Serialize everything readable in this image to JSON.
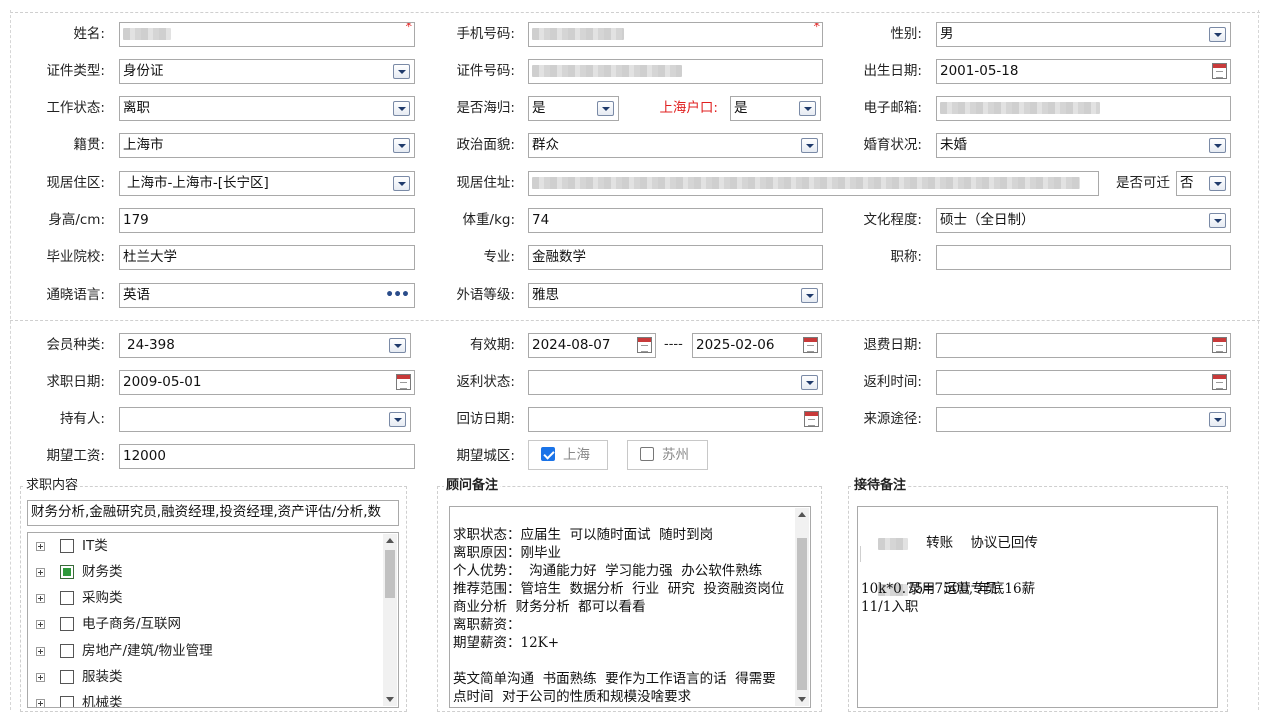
{
  "personal": {
    "name": {
      "label": "姓名:"
    },
    "phone": {
      "label": "手机号码:"
    },
    "gender": {
      "label": "性别:",
      "value": "男"
    },
    "id_type": {
      "label": "证件类型:",
      "value": "身份证"
    },
    "id_number": {
      "label": "证件号码:"
    },
    "birth_date": {
      "label": "出生日期:",
      "value": "2001-05-18"
    },
    "work_status": {
      "label": "工作状态:",
      "value": "离职"
    },
    "returnee": {
      "label": "是否海归:",
      "value": "是"
    },
    "shanghai_hukou": {
      "label": "上海户口:",
      "value": "是"
    },
    "email": {
      "label": "电子邮箱:"
    },
    "native_place": {
      "label": "籍贯:",
      "value": "上海市"
    },
    "political": {
      "label": "政治面貌:",
      "value": "群众"
    },
    "marital": {
      "label": "婚育状况:",
      "value": "未婚"
    },
    "residence_area": {
      "label": "现居住区:",
      "value": "上海市-上海市-[长宁区]"
    },
    "address": {
      "label": "现居住址:"
    },
    "relocate": {
      "label": "是否可迁",
      "value": "否"
    },
    "height": {
      "label": "身高/cm:",
      "value": "179"
    },
    "weight": {
      "label": "体重/kg:",
      "value": "74"
    },
    "education": {
      "label": "文化程度:",
      "value": "硕士（全日制）"
    },
    "school": {
      "label": "毕业院校:",
      "value": "杜兰大学"
    },
    "major": {
      "label": "专业:",
      "value": "金融数学"
    },
    "title": {
      "label": "职称:",
      "value": ""
    },
    "languages": {
      "label": "通晓语言:",
      "value": "英语"
    },
    "lang_level": {
      "label": "外语等级:",
      "value": "雅思"
    },
    "required_mark": "*",
    "more_icon": "•••"
  },
  "membership": {
    "member_type": {
      "label": "会员种类:",
      "value": "24-398"
    },
    "valid_period": {
      "label": "有效期:",
      "from": "2024-08-07",
      "to": "2025-02-06",
      "separator": "----"
    },
    "refund_date": {
      "label": "退费日期:",
      "value": ""
    },
    "job_date": {
      "label": "求职日期:",
      "value": "2009-05-01"
    },
    "rebate_status": {
      "label": "返利状态:",
      "value": ""
    },
    "rebate_time": {
      "label": "返利时间:",
      "value": ""
    },
    "holder": {
      "label": "持有人:",
      "value": ""
    },
    "visit_date": {
      "label": "回访日期:",
      "value": ""
    },
    "source": {
      "label": "来源途径:",
      "value": ""
    },
    "salary": {
      "label": "期望工资:",
      "value": "12000"
    },
    "city": {
      "label": "期望城区:",
      "options": [
        {
          "label": "上海",
          "checked": true
        },
        {
          "label": "苏州",
          "checked": false
        }
      ]
    }
  },
  "job_content": {
    "title": "求职内容",
    "selected_text": "财务分析,金融研究员,融资经理,投资经理,资产评估/分析,数",
    "tree": [
      {
        "label": "IT类",
        "checked": false
      },
      {
        "label": "财务类",
        "checked": true
      },
      {
        "label": "采购类",
        "checked": false
      },
      {
        "label": "电子商务/互联网",
        "checked": false
      },
      {
        "label": "房地产/建筑/物业管理",
        "checked": false
      },
      {
        "label": "服装类",
        "checked": false
      },
      {
        "label": "机械类",
        "checked": false
      }
    ]
  },
  "consultant_notes": {
    "title": "顾问备注",
    "lines": [
      "",
      "求职状态：应届生  可以随时面试  随时到岗",
      "离职原因：刚毕业",
      "个人优势：  沟通能力好  学习能力强  办公软件熟练",
      "推荐范围：管培生  数据分析  行业  研究  投资融资岗位",
      "商业分析  财务分析  都可以看看",
      "离职薪资：",
      "期望薪资：12K+",
      "",
      "英文简单沟通  书面熟练  要作为工作语言的话  得需要",
      "点时间  对于公司的性质和规模没啥要求"
    ]
  },
  "reception_notes": {
    "title": "接待备注",
    "line1": "转账    协议已回传",
    "line3": "录用  运营专员",
    "line4": "10k*0.75=7500, 年底16薪",
    "line5": "11/1入职"
  },
  "colors": {
    "accent_red": "#e02020",
    "checkbox_blue": "#1a73e8",
    "tree_checked_green": "#2e9a3a"
  }
}
